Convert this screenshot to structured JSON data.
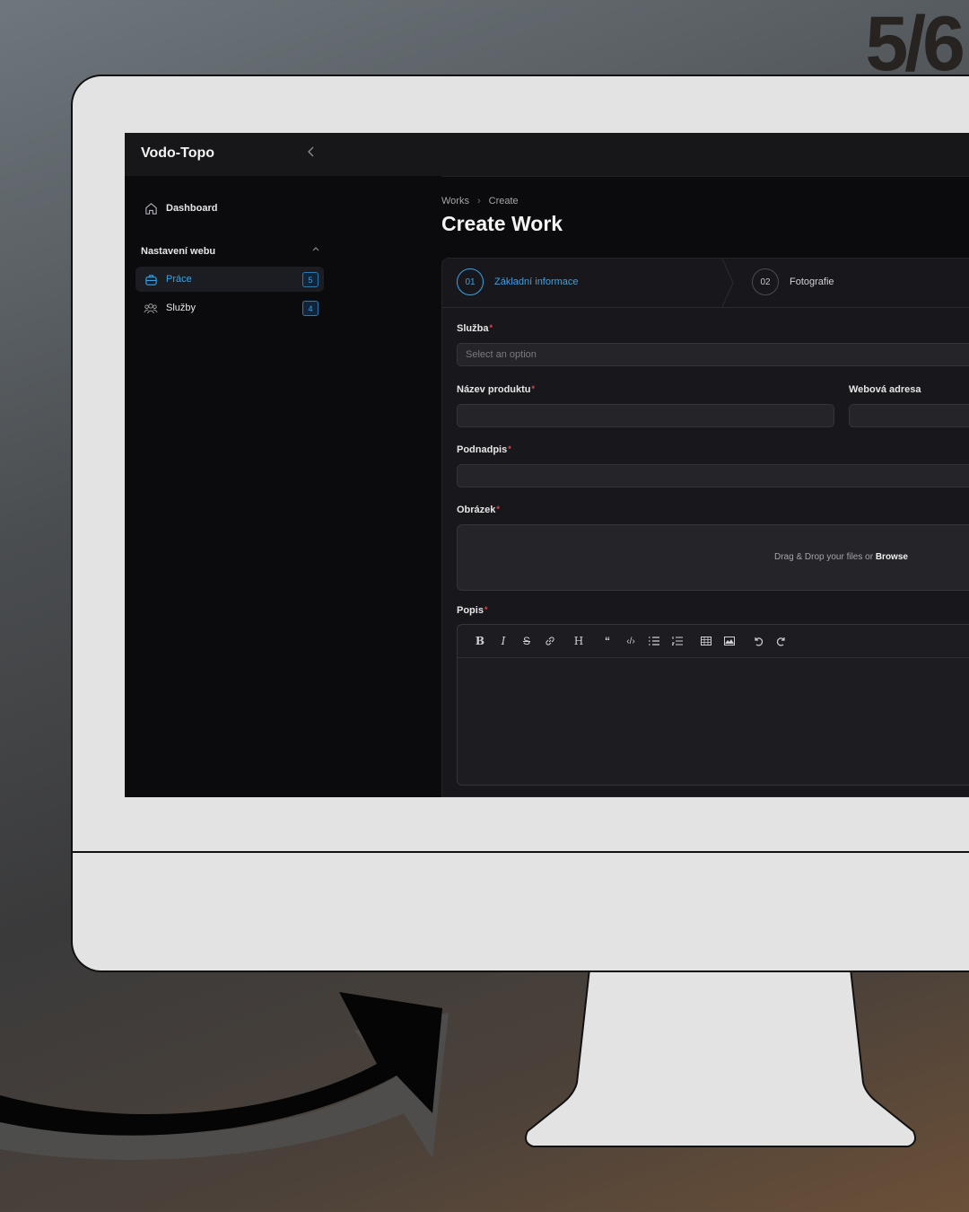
{
  "slide_counter": "5/6",
  "app": {
    "brand": "Vodo-Topo",
    "collapse_icon": "chevron-left-icon"
  },
  "sidebar": {
    "dashboard": "Dashboard",
    "group_title": "Nastavení webu",
    "items": [
      {
        "label": "Práce",
        "count": "5",
        "icon": "briefcase-icon",
        "active": true
      },
      {
        "label": "Služby",
        "count": "4",
        "icon": "users-icon",
        "active": false
      }
    ]
  },
  "breadcrumb": {
    "parent": "Works",
    "current": "Create"
  },
  "page_title": "Create Work",
  "steps": [
    {
      "num": "01",
      "label": "Základní informace",
      "active": true
    },
    {
      "num": "02",
      "label": "Fotografie",
      "active": false
    }
  ],
  "form": {
    "sluzba_label": "Služba",
    "sluzba_placeholder": "Select an option",
    "nazev_label": "Název produktu",
    "webova_label": "Webová adresa",
    "podnadpis_label": "Podnadpis",
    "obrazek_label": "Obrázek",
    "dropzone_text": "Drag & Drop your files or",
    "dropzone_browse": "Browse",
    "popis_label": "Popis",
    "required_mark": "*"
  },
  "toolbar_icons": [
    "bold-icon",
    "italic-icon",
    "strikethrough-icon",
    "link-icon",
    "heading-icon",
    "quote-icon",
    "code-icon",
    "bullet-list-icon",
    "ordered-list-icon",
    "table-icon",
    "image-icon",
    "undo-icon",
    "redo-icon"
  ],
  "colors": {
    "accent": "#38a3e8",
    "required": "#e34848",
    "background": "#0b0b0d"
  }
}
